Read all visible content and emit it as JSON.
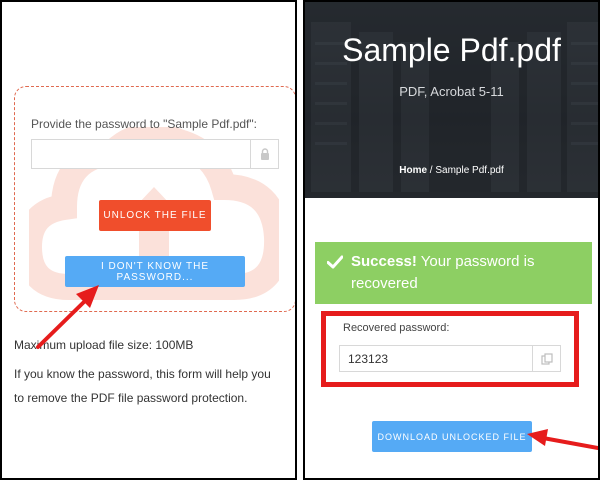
{
  "left": {
    "password_prompt": "Provide the password to \"Sample Pdf.pdf\":",
    "password_value": "",
    "password_placeholder": "",
    "unlock_button": "UNLOCK THE FILE",
    "dont_know_button": "I DON'T KNOW THE PASSWORD...",
    "max_upload": "Maximum upload file size: 100MB",
    "help_text": "If you know the password, this form will help you to remove the PDF file password protection."
  },
  "right": {
    "title": "Sample Pdf.pdf",
    "subtitle": "PDF, Acrobat 5-11",
    "breadcrumb_home": "Home",
    "breadcrumb_separator": " / ",
    "breadcrumb_current": "Sample Pdf.pdf",
    "success_strong": "Success!",
    "success_message": " Your password is recovered",
    "recovered_label": "Recovered password:",
    "recovered_value": "123123",
    "download_button": "DOWNLOAD UNLOCKED FILE"
  },
  "colors": {
    "unlock_button": "#f04e2c",
    "blue_button": "#55aaf5",
    "success_bg": "#8dcf63",
    "annotation_red": "#e61c1c",
    "dashed_border": "#e06a50"
  },
  "icons": [
    "lock-icon",
    "copy-icon",
    "checkmark-icon",
    "cloud-upload-icon",
    "annotation-arrow"
  ]
}
